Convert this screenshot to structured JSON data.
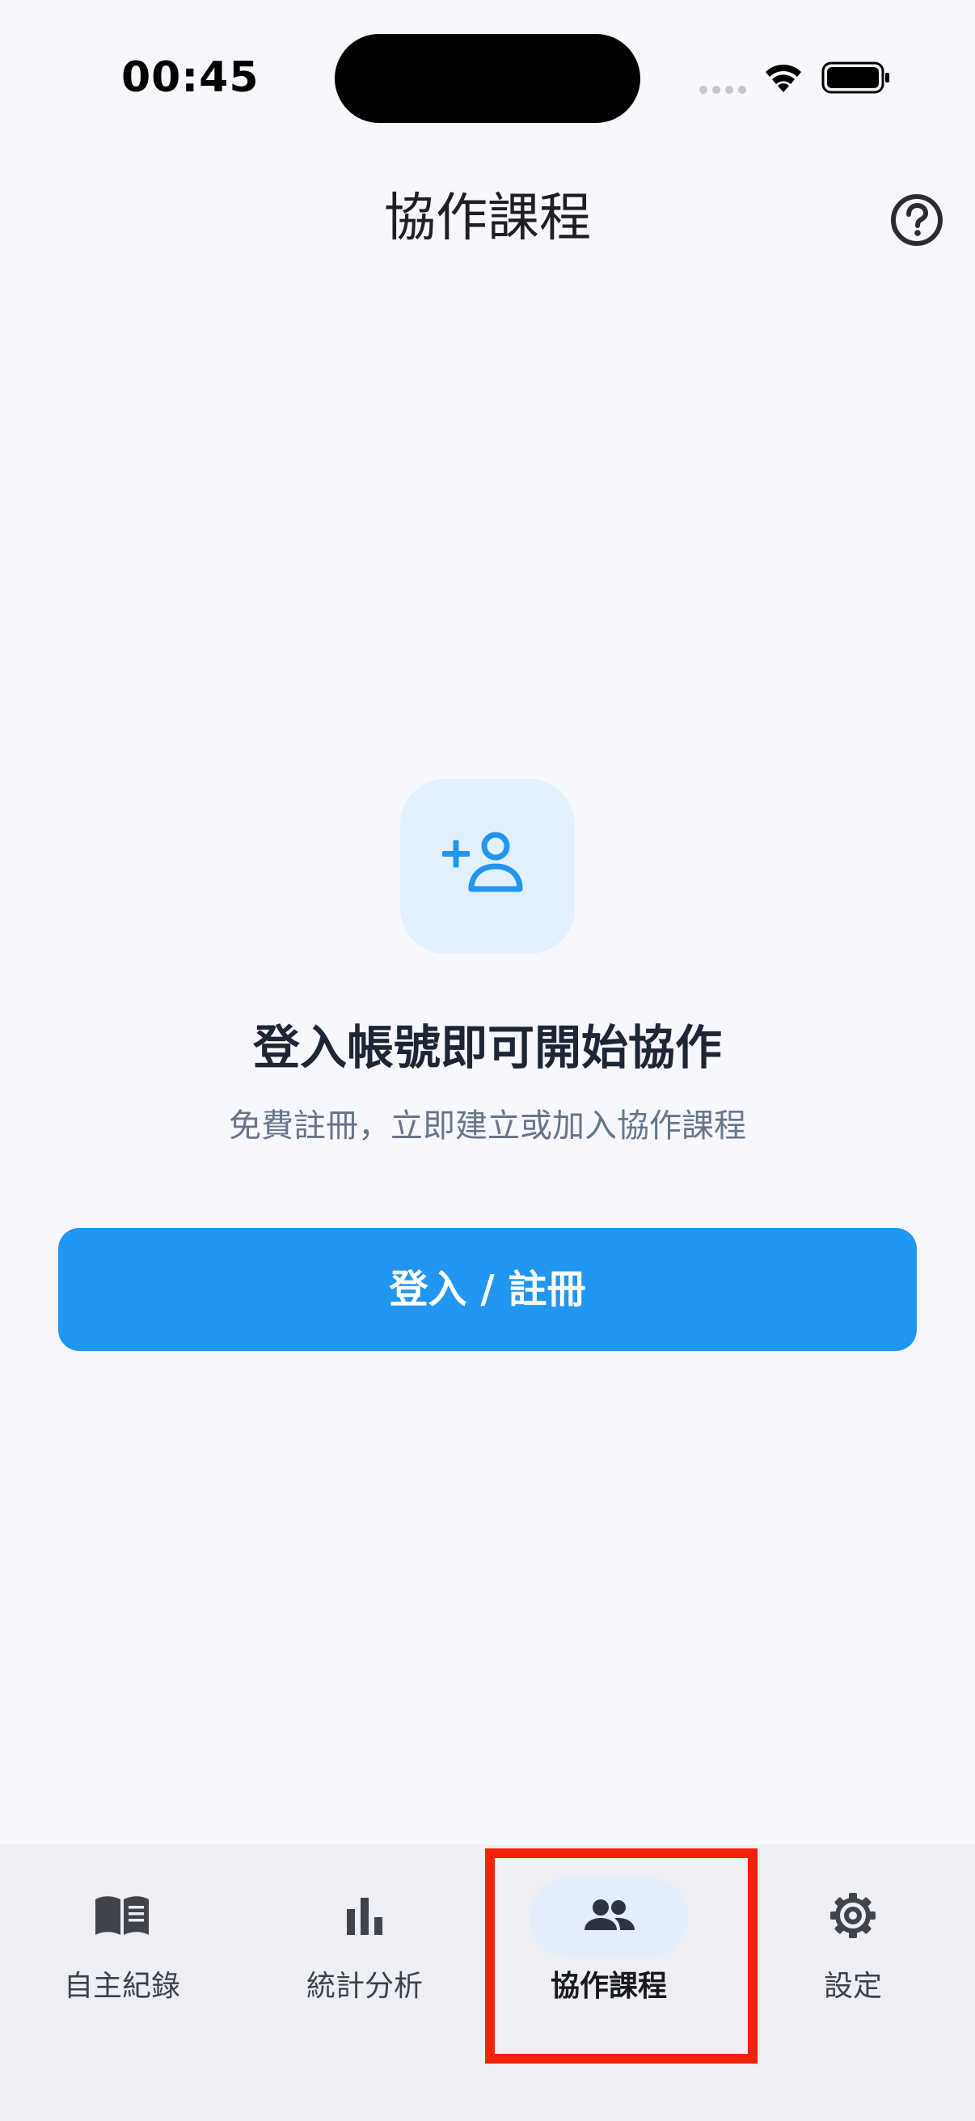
{
  "status_bar": {
    "time": "00:45"
  },
  "header": {
    "title": "協作課程",
    "help_icon": "help-circle-icon"
  },
  "empty_state": {
    "icon": "person-add-icon",
    "title": "登入帳號即可開始協作",
    "subtitle": "免費註冊，立即建立或加入協作課程",
    "button_label": "登入 / 註冊"
  },
  "bottom_nav": {
    "items": [
      {
        "label": "自主紀錄",
        "icon": "book-icon",
        "active": false
      },
      {
        "label": "統計分析",
        "icon": "bar-chart-icon",
        "active": false
      },
      {
        "label": "協作課程",
        "icon": "people-icon",
        "active": true
      },
      {
        "label": "設定",
        "icon": "gear-icon",
        "active": false
      }
    ]
  },
  "colors": {
    "background": "#f6f8fd",
    "accent": "#2196f0",
    "icon_bg": "#e2f0fd",
    "nav_bg": "#edeff4",
    "highlight": "#f5210a"
  }
}
